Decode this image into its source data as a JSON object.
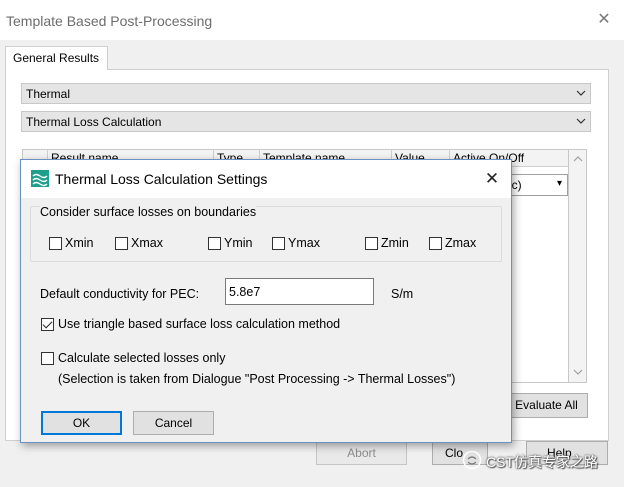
{
  "main": {
    "title": "Template Based Post-Processing",
    "close_glyph": "✕",
    "tab_general": "General Results",
    "combo_category": "Thermal",
    "combo_template": "Thermal Loss Calculation",
    "table_headers": [
      "Result name",
      "Type",
      "Template name",
      "Value",
      "Active On/Off"
    ],
    "row_active_value": "etric)",
    "btn_evaluate_all": "Evaluate All",
    "btn_abort": "Abort",
    "btn_close_partial": "Clo",
    "btn_help_partial": "Help"
  },
  "watermark": {
    "text": "CST仿真专家之路"
  },
  "dialog": {
    "title": "Thermal Loss Calculation Settings",
    "close_glyph": "✕",
    "group_label": "Consider surface losses on boundaries",
    "boundaries": [
      {
        "label": "Xmin",
        "checked": false
      },
      {
        "label": "Xmax",
        "checked": false
      },
      {
        "label": "Ymin",
        "checked": false
      },
      {
        "label": "Ymax",
        "checked": false
      },
      {
        "label": "Zmin",
        "checked": false
      },
      {
        "label": "Zmax",
        "checked": false
      }
    ],
    "pec_label": "Default conductivity for PEC:",
    "pec_value": "5.8e7",
    "pec_unit": "S/m",
    "triangle_label": "Use triangle based surface loss calculation method",
    "triangle_checked": true,
    "selected_label": "Calculate selected losses only",
    "selected_checked": false,
    "selected_note": "(Selection is taken from Dialogue \"Post Processing -> Thermal Losses\")",
    "ok_label": "OK",
    "cancel_label": "Cancel"
  },
  "colors": {
    "focus_border": "#0078d7",
    "dialog_border": "#6b90c4",
    "icon_teal": "#1e9e8c"
  },
  "icons": {
    "dialog_icon": "thermal-wave-icon",
    "dropdown": "chevron-down-icon",
    "scroll_up": "chevron-up-icon",
    "scroll_down": "chevron-down-icon"
  }
}
